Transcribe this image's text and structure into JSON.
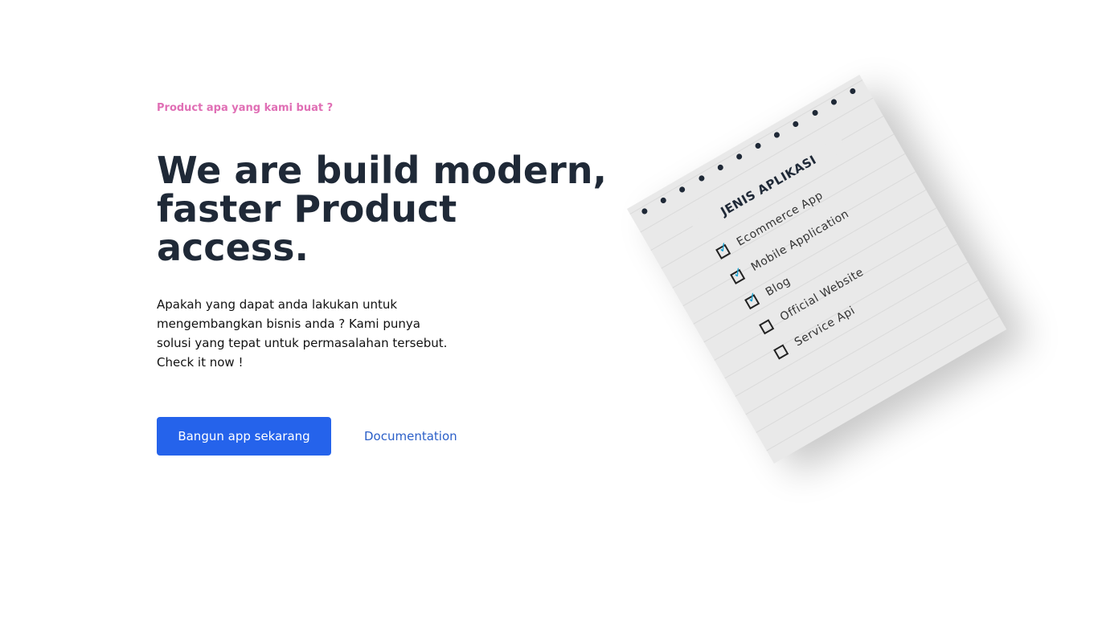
{
  "hero": {
    "eyebrow": "Product apa yang kami buat ?",
    "headline_line1": "We are build modern,",
    "headline_line2": "faster Product",
    "headline_line3": "access.",
    "description": "Apakah yang dapat anda lakukan untuk mengembangkan bisnis anda ? Kami punya solusi yang tepat untuk permasalahan tersebut. Check it now !",
    "primary_button": "Bangun app sekarang",
    "secondary_link": "Documentation"
  },
  "notepad": {
    "title": "JENIS APLIKASI",
    "items": [
      {
        "label": "Ecommerce App",
        "checked": true
      },
      {
        "label": "Mobile Application",
        "checked": true
      },
      {
        "label": "Blog",
        "checked": true
      },
      {
        "label": "Official Website",
        "checked": false
      },
      {
        "label": "Service Api",
        "checked": false
      }
    ],
    "checkmark_glyph": "✓"
  },
  "colors": {
    "accent": "#2563eb",
    "eyebrow": "#e06fb5",
    "heading": "#1f2937",
    "link": "#2b5fc8",
    "check": "#1aa5d6"
  }
}
